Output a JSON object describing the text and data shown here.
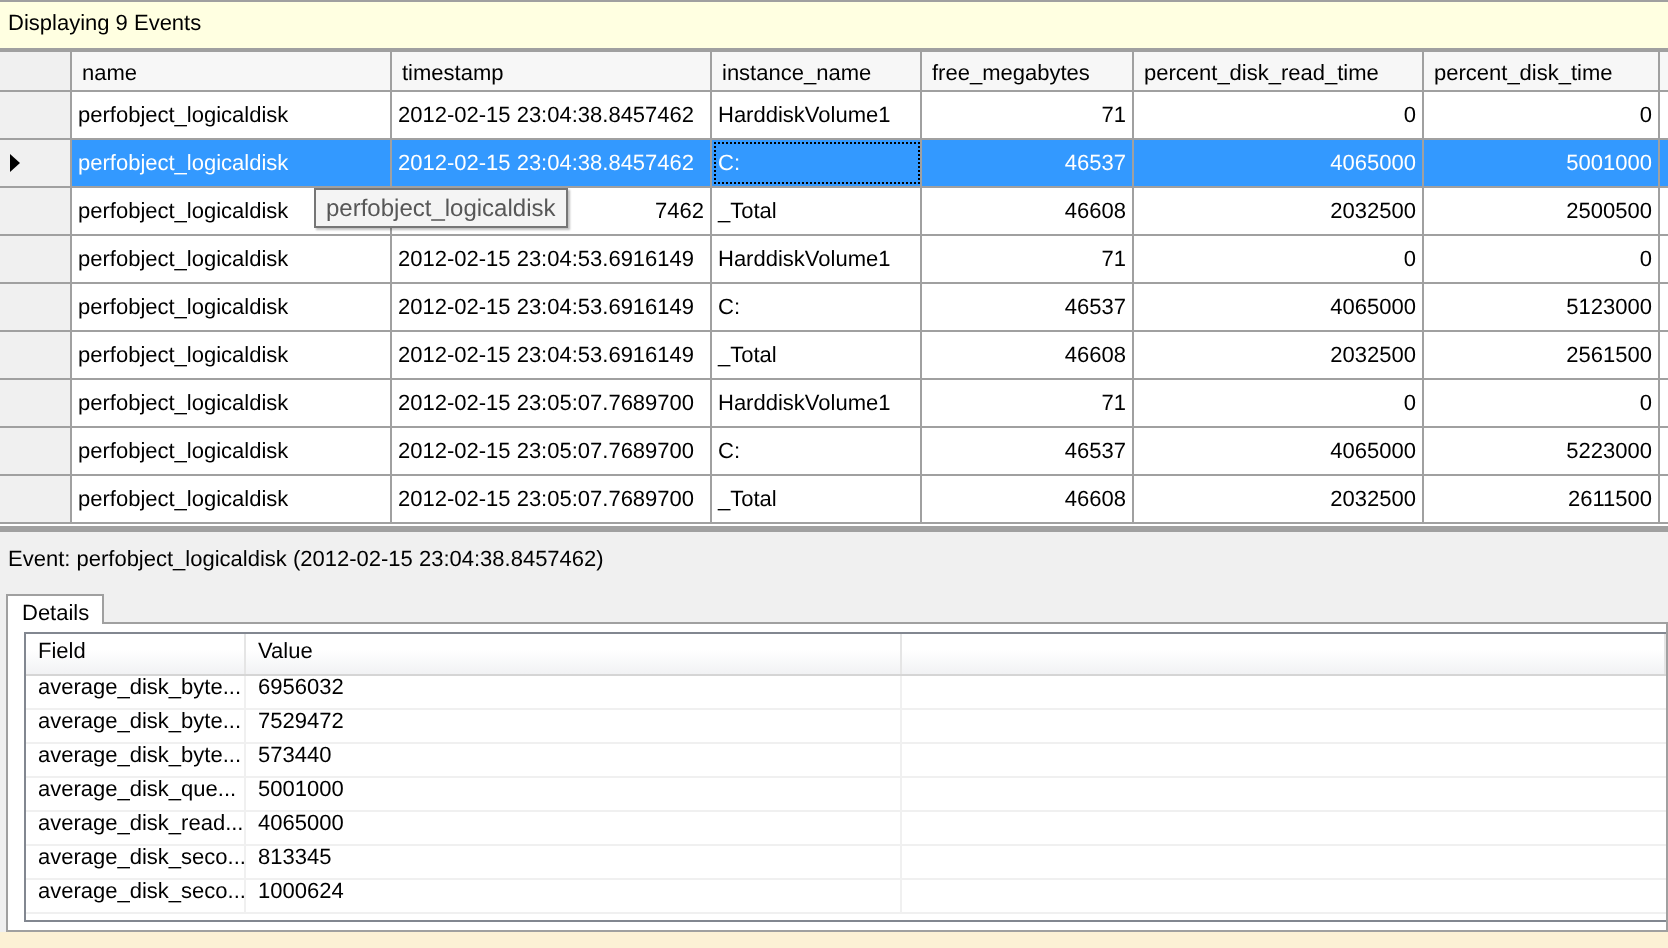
{
  "header": {
    "title": "Displaying 9 Events"
  },
  "grid": {
    "columns": [
      {
        "label": "name",
        "kind": "text"
      },
      {
        "label": "timestamp",
        "kind": "text"
      },
      {
        "label": "instance_name",
        "kind": "text"
      },
      {
        "label": "free_megabytes",
        "kind": "number"
      },
      {
        "label": "percent_disk_read_time",
        "kind": "number"
      },
      {
        "label": "percent_disk_time",
        "kind": "number"
      }
    ],
    "rows": [
      {
        "selected": false,
        "cells": [
          "perfobject_logicaldisk",
          "2012-02-15 23:04:38.8457462",
          "HarddiskVolume1",
          "71",
          "0",
          "0"
        ]
      },
      {
        "selected": true,
        "tooltip": "perfobject_logicaldisk",
        "cells": [
          "perfobject_logicaldisk",
          "2012-02-15 23:04:38.8457462",
          "C:",
          "46537",
          "4065000",
          "5001000"
        ]
      },
      {
        "selected": false,
        "cells": [
          "perfobject_logicaldisk",
          "7462",
          "_Total",
          "46608",
          "2032500",
          "2500500"
        ]
      },
      {
        "selected": false,
        "cells": [
          "perfobject_logicaldisk",
          "2012-02-15 23:04:53.6916149",
          "HarddiskVolume1",
          "71",
          "0",
          "0"
        ]
      },
      {
        "selected": false,
        "cells": [
          "perfobject_logicaldisk",
          "2012-02-15 23:04:53.6916149",
          "C:",
          "46537",
          "4065000",
          "5123000"
        ]
      },
      {
        "selected": false,
        "cells": [
          "perfobject_logicaldisk",
          "2012-02-15 23:04:53.6916149",
          "_Total",
          "46608",
          "2032500",
          "2561500"
        ]
      },
      {
        "selected": false,
        "cells": [
          "perfobject_logicaldisk",
          "2012-02-15 23:05:07.7689700",
          "HarddiskVolume1",
          "71",
          "0",
          "0"
        ]
      },
      {
        "selected": false,
        "cells": [
          "perfobject_logicaldisk",
          "2012-02-15 23:05:07.7689700",
          "C:",
          "46537",
          "4065000",
          "5223000"
        ]
      },
      {
        "selected": false,
        "cells": [
          "perfobject_logicaldisk",
          "2012-02-15 23:05:07.7689700",
          "_Total",
          "46608",
          "2032500",
          "2611500"
        ]
      }
    ]
  },
  "event_label": "Event: perfobject_logicaldisk (2012-02-15 23:04:38.8457462)",
  "tabs": [
    {
      "label": "Details",
      "selected": true
    }
  ],
  "details": {
    "columns": [
      "Field",
      "Value"
    ],
    "rows": [
      {
        "field": "average_disk_byte...",
        "value": "6956032"
      },
      {
        "field": "average_disk_byte...",
        "value": "7529472"
      },
      {
        "field": "average_disk_byte...",
        "value": "573440"
      },
      {
        "field": "average_disk_que...",
        "value": "5001000"
      },
      {
        "field": "average_disk_read...",
        "value": "4065000"
      },
      {
        "field": "average_disk_seco...",
        "value": "813345"
      },
      {
        "field": "average_disk_seco...",
        "value": "1000624"
      }
    ]
  }
}
